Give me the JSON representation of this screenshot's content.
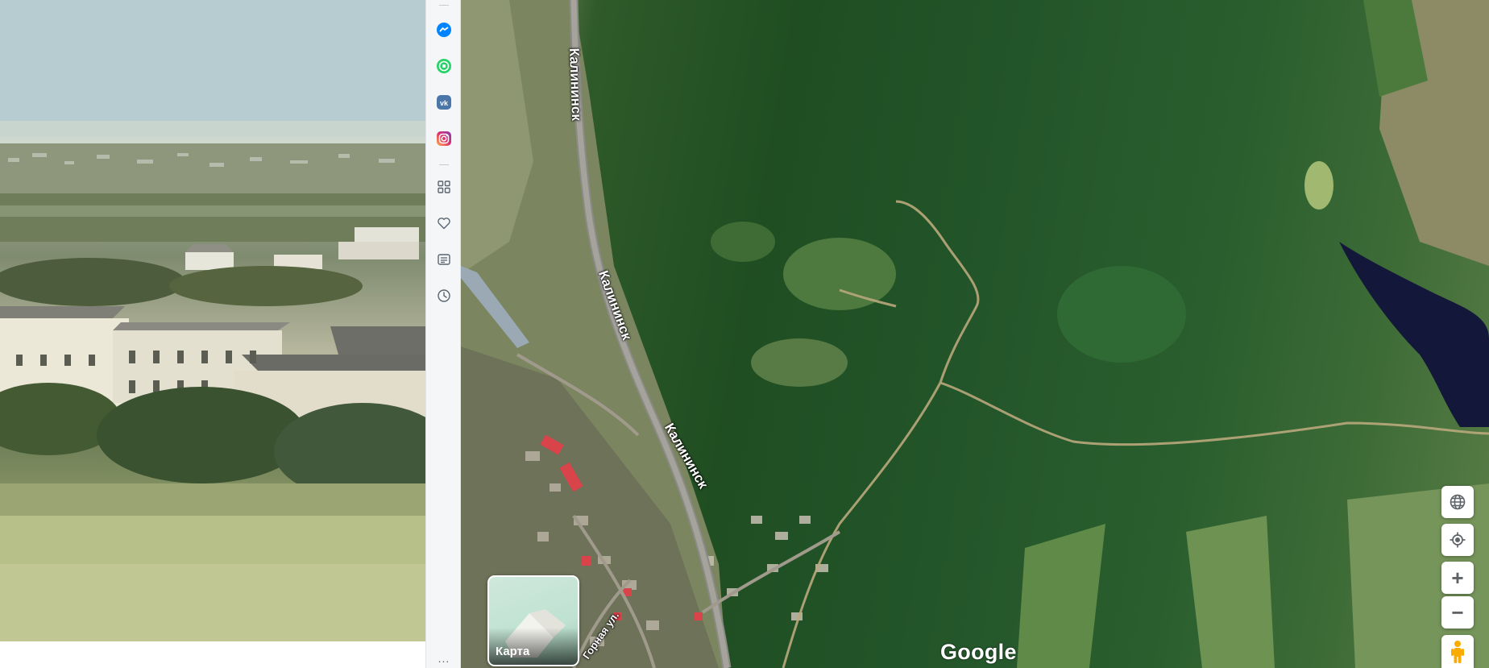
{
  "sidebar": {
    "items": [
      {
        "name": "messenger-icon",
        "color": "#0084ff"
      },
      {
        "name": "whatsapp-icon",
        "color": "#25d366"
      },
      {
        "name": "vk-icon",
        "color": "#4a76a8"
      },
      {
        "name": "instagram-icon",
        "color": "#d6249f"
      },
      {
        "name": "apps-grid-icon"
      },
      {
        "name": "heart-icon"
      },
      {
        "name": "news-feed-icon"
      },
      {
        "name": "history-clock-icon"
      }
    ],
    "more_label": "..."
  },
  "map": {
    "road_label_1": "Калининск",
    "road_label_2": "Калининск",
    "road_label_3": "Калининск",
    "street_label": "Горная ул.",
    "google_logo": "Google",
    "minimap_label": "Карта",
    "controls": {
      "zoom_in": "+",
      "zoom_out": "−"
    }
  },
  "colors": {
    "forest": "#1f4e22",
    "sidebar_bg": "#f4f6f8",
    "control_bg": "#ffffff",
    "pegman": "#f9ab00"
  }
}
